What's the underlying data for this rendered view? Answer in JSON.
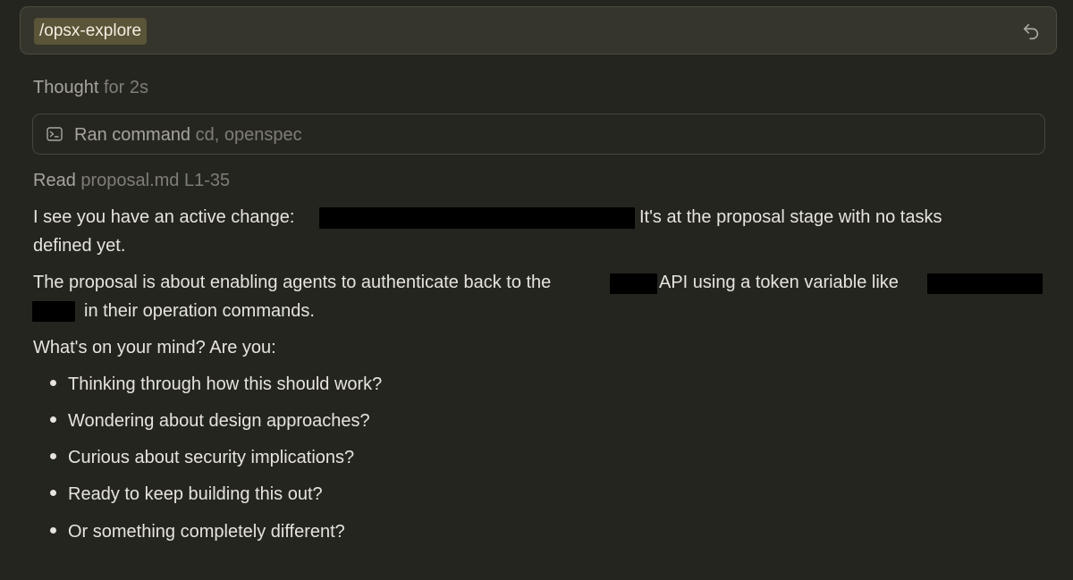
{
  "prompt": {
    "command": "/opsx-explore",
    "undo_icon": "undo-icon"
  },
  "thought": {
    "lead": "Thought",
    "rest": "for 2s"
  },
  "ran_command": {
    "icon": "terminal-icon",
    "lead": "Ran command",
    "rest": "cd, openspec"
  },
  "read": {
    "lead": "Read",
    "rest": "proposal.md L1-35"
  },
  "message": {
    "p1_part1": "I see you have an active change:",
    "p1_part2": "It's at the proposal stage with no tasks",
    "p1_line2": "defined yet.",
    "p2_part1": "The proposal is about enabling agents to authenticate back to the",
    "p2_part2": "API using a token variable like",
    "p2_line2": "in their operation commands.",
    "question": "What's on your mind? Are you:",
    "options": [
      "Thinking through how this should work?",
      "Wondering about design approaches?",
      "Curious about security implications?",
      "Ready to keep building this out?",
      "Or something completely different?"
    ]
  },
  "colors": {
    "background": "#252520",
    "prompt_background": "#35352c",
    "chip_background": "#5a5538",
    "text": "#e6e4dc",
    "muted_text": "#7f7d75",
    "redaction": "#000000"
  }
}
